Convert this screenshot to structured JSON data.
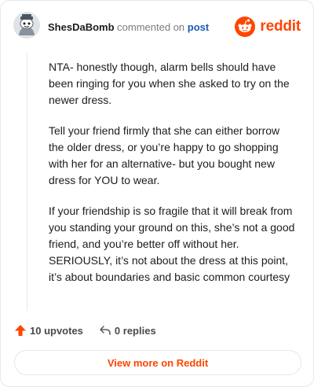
{
  "header": {
    "username": "ShesDaBomb",
    "action": "commented on",
    "target": "post",
    "brand": "reddit"
  },
  "comment": {
    "paragraphs": [
      "NTA- honestly though, alarm bells should have been ringing for you when she asked to try on the newer dress.",
      "Tell your friend firmly that she can either borrow the older dress, or you’re happy to go shopping with her for an alternative- but you bought new dress for YOU to wear.",
      "If your friendship is so fragile that it will break from you standing your ground on this, she’s not a good friend, and you’re better off without her. SERIOUSLY, it’s not about the dress at this point, it’s about boundaries and basic common courtesy"
    ]
  },
  "footer": {
    "upvotes_label": "10 upvotes",
    "replies_label": "0 replies",
    "view_more_label": "View more on Reddit"
  },
  "colors": {
    "accent": "#ff4500",
    "link": "#1a5db0",
    "text": "#1c1c1c",
    "muted": "#7c7c7c"
  },
  "icons": {
    "avatar": "snoo-avatar",
    "brand": "reddit-logo-icon",
    "upvote": "upvote-arrow-icon",
    "reply": "reply-arrow-icon"
  }
}
